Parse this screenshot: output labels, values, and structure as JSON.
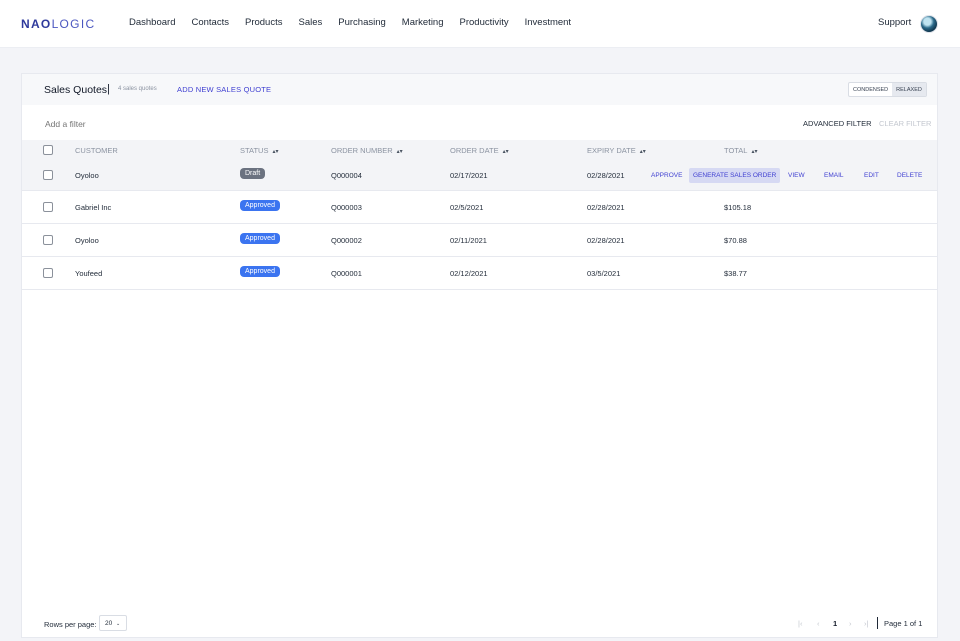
{
  "brand": {
    "logo_bold": "NAO",
    "logo_rest": "LOGIC"
  },
  "nav": {
    "items": [
      "Dashboard",
      "Contacts",
      "Products",
      "Sales",
      "Purchasing",
      "Marketing",
      "Productivity",
      "Investment"
    ],
    "support": "Support"
  },
  "header": {
    "title": "Sales Quotes",
    "separator": "|",
    "count": "4 sales quotes",
    "add_label": "ADD NEW SALES QUOTE",
    "view_toggle": [
      "CONDENSED",
      "RELAXED"
    ],
    "view_selected": "RELAXED"
  },
  "filter": {
    "placeholder": "Add a filter",
    "advanced_label": "ADVANCED FILTER",
    "clear_label": "CLEAR FILTER"
  },
  "table": {
    "columns": [
      "CUSTOMER",
      "STATUS",
      "ORDER NUMBER",
      "ORDER DATE",
      "EXPIRY DATE",
      "TOTAL"
    ],
    "rows": [
      {
        "customer": "Oyoloo",
        "status": "Draft",
        "order_number": "Q000004",
        "order_date": "02/17/2021",
        "expiry_date": "02/28/2021",
        "total": ""
      },
      {
        "customer": "Gabriel Inc",
        "status": "Approved",
        "order_number": "Q000003",
        "order_date": "02/5/2021",
        "expiry_date": "02/28/2021",
        "total": "$105.18"
      },
      {
        "customer": "Oyoloo",
        "status": "Approved",
        "order_number": "Q000002",
        "order_date": "02/11/2021",
        "expiry_date": "02/28/2021",
        "total": "$70.88"
      },
      {
        "customer": "Youfeed",
        "status": "Approved",
        "order_number": "Q000001",
        "order_date": "02/12/2021",
        "expiry_date": "03/5/2021",
        "total": "$38.77"
      }
    ],
    "row_actions": [
      "APPROVE",
      "GENERATE SALES ORDER",
      "VIEW",
      "EMAIL",
      "EDIT",
      "DELETE"
    ]
  },
  "pagination": {
    "rows_per_page_label": "Rows per page:",
    "rows_per_page": "20",
    "current_page": "1",
    "page_info": "Page 1 of 1"
  },
  "colors": {
    "accent": "#3f3fd1",
    "approved": "#3b74f0",
    "draft": "#6b7280"
  },
  "icons": [
    "sort-icon",
    "chevron-down-icon",
    "first-page-icon",
    "prev-page-icon",
    "next-page-icon",
    "last-page-icon",
    "avatar"
  ]
}
